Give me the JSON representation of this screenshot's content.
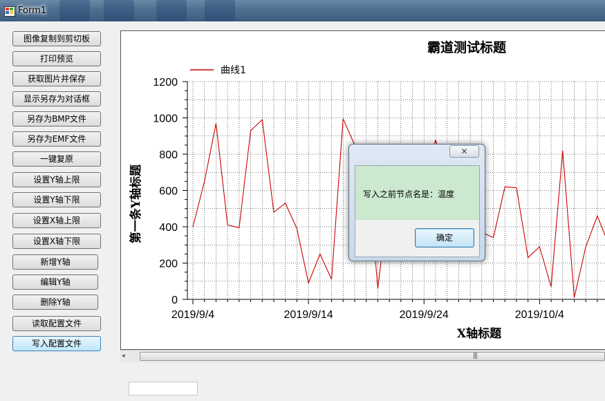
{
  "window": {
    "title": "Form1"
  },
  "buttons": [
    "图像复制到剪切板",
    "打印预览",
    "获取图片并保存",
    "显示另存为对话框",
    "另存为BMP文件",
    "另存为EMF文件",
    "一键复原",
    "设置Y轴上限",
    "设置Y轴下限",
    "设置X轴上限",
    "设置X轴下限",
    "新增Y轴",
    "编辑Y轴",
    "删除Y轴",
    "读取配置文件",
    "写入配置文件"
  ],
  "dialog": {
    "message": "写入之前节点名是：温度",
    "ok_label": "确定",
    "close_symbol": "✕"
  },
  "colors": {
    "series": "#cc0000",
    "dialog_message_bg": "#cce8cf"
  },
  "chart_data": {
    "type": "line",
    "title": "霸道测试标题",
    "xlabel": "X轴标题",
    "ylabel": "第一条Y轴标题",
    "legend_position": "top-left",
    "grid": true,
    "ylim": [
      0,
      1200
    ],
    "yticks": [
      "0",
      "200",
      "400",
      "600",
      "800",
      "1000",
      "1200"
    ],
    "xticks": [
      "2019/9/4",
      "2019/9/14",
      "2019/9/24",
      "2019/10/4"
    ],
    "x_start": "2019/9/4",
    "series": [
      {
        "name": "曲线1",
        "color": "#cc0000",
        "x": [
          "2019/9/4",
          "2019/9/5",
          "2019/9/6",
          "2019/9/7",
          "2019/9/8",
          "2019/9/9",
          "2019/9/10",
          "2019/9/11",
          "2019/9/12",
          "2019/9/13",
          "2019/9/14",
          "2019/9/15",
          "2019/9/16",
          "2019/9/17",
          "2019/9/18",
          "2019/9/19",
          "2019/9/20",
          "2019/9/21",
          "2019/9/22",
          "2019/9/23",
          "2019/9/24",
          "2019/9/25",
          "2019/9/26",
          "2019/9/27",
          "2019/9/28",
          "2019/9/29",
          "2019/9/30",
          "2019/10/1",
          "2019/10/2",
          "2019/10/3",
          "2019/10/4",
          "2019/10/5",
          "2019/10/6",
          "2019/10/7",
          "2019/10/8",
          "2019/10/9",
          "2019/10/10"
        ],
        "values": [
          400,
          650,
          970,
          410,
          395,
          930,
          990,
          480,
          530,
          390,
          90,
          250,
          110,
          995,
          850,
          830,
          60,
          590,
          690,
          830,
          610,
          880,
          620,
          420,
          410,
          370,
          340,
          620,
          615,
          230,
          290,
          70,
          820,
          10,
          290,
          460,
          300
        ]
      }
    ]
  }
}
